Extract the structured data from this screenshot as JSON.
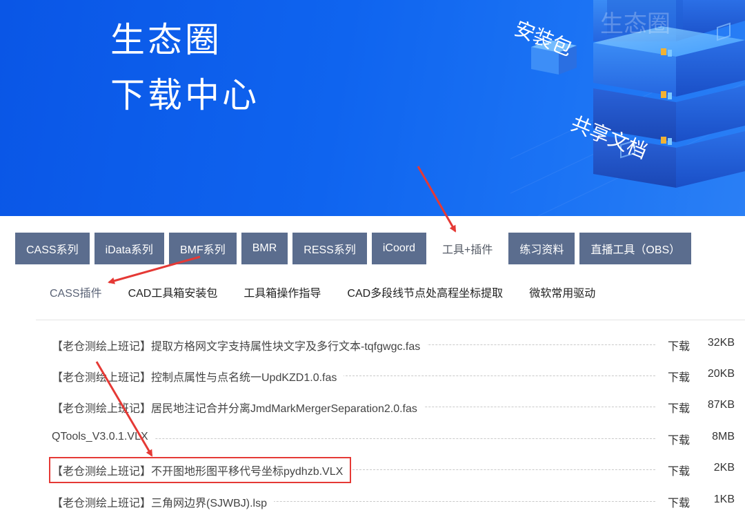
{
  "banner": {
    "title_line1": "生态圈",
    "title_line2": "下载中心",
    "label_cube": "生态圈",
    "label_package": "安装包",
    "label_shared": "共享文档"
  },
  "tabs": [
    {
      "label": "CASS系列",
      "active": false
    },
    {
      "label": "iData系列",
      "active": false
    },
    {
      "label": "BMF系列",
      "active": false
    },
    {
      "label": "BMR",
      "active": false
    },
    {
      "label": "RESS系列",
      "active": false
    },
    {
      "label": "iCoord",
      "active": false
    },
    {
      "label": "工具+插件",
      "active": true
    },
    {
      "label": "练习资料",
      "active": false
    },
    {
      "label": "直播工具（OBS）",
      "active": false
    }
  ],
  "subtabs": [
    {
      "label": "CASS插件",
      "active": true
    },
    {
      "label": "CAD工具箱安装包",
      "active": false
    },
    {
      "label": "工具箱操作指导",
      "active": false
    },
    {
      "label": "CAD多段线节点处高程坐标提取",
      "active": false
    },
    {
      "label": "微软常用驱动",
      "active": false
    }
  ],
  "files": [
    {
      "name": "【老仓测绘上班记】提取方格网文字支持属性块文字及多行文本-tqfgwgc.fas",
      "action": "下载",
      "size": "32KB"
    },
    {
      "name": "【老仓测绘上班记】控制点属性与点名统一UpdKZD1.0.fas",
      "action": "下载",
      "size": "20KB"
    },
    {
      "name": "【老仓测绘上班记】居民地注记合并分离JmdMarkMergerSeparation2.0.fas",
      "action": "下载",
      "size": "87KB"
    },
    {
      "name": "QTools_V3.0.1.VLX",
      "action": "下载",
      "size": "8MB"
    },
    {
      "name": "【老仓测绘上班记】不开图地形图平移代号坐标pydhzb.VLX",
      "action": "下载",
      "size": "2KB"
    },
    {
      "name": "【老仓测绘上班记】三角网边界(SJWBJ).lsp",
      "action": "下载",
      "size": "1KB"
    }
  ],
  "colors": {
    "banner_blue": "#0f64ef",
    "tab_bg": "#5b6d8e",
    "annotation_red": "#e53935"
  }
}
